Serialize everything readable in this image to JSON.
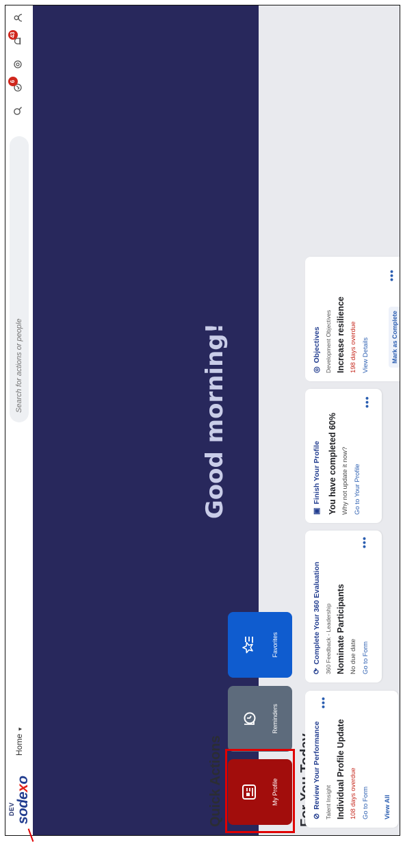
{
  "header": {
    "logo_dev": "DEV",
    "logo_word": "sodexo",
    "home_label": "Home",
    "search_placeholder": "Search for actions or people",
    "notifications_count": "6",
    "alerts_count": "43"
  },
  "banner": {
    "greeting": "Good morning!"
  },
  "quick_actions": {
    "title": "Quick Actions",
    "items": [
      {
        "label": "My Profile",
        "icon": "profile-card-icon",
        "color": "#a20d0c"
      },
      {
        "label": "Reminders",
        "icon": "reminder-icon",
        "color": "#5d6b7c"
      },
      {
        "label": "Favorites",
        "icon": "star-list-icon",
        "color": "#0f5ccf"
      }
    ]
  },
  "for_you": {
    "title": "For You Today",
    "cards": [
      {
        "title": "Review Your Performance",
        "subtitle": "Talent Insight",
        "main": "Individual Profile Update",
        "meta": "108 days overdue",
        "link": "Go to Form",
        "footer": "View All"
      },
      {
        "title": "Complete Your 360 Evaluation",
        "subtitle": "360 Feedback - Leadership",
        "main": "Nominate Participants",
        "meta": "No due date",
        "link": "Go to Form"
      },
      {
        "title": "Finish Your Profile",
        "main": "You have completed 60%",
        "meta": "Why not update it now?",
        "link": "Go to Your Profile"
      },
      {
        "title": "Objectives",
        "subtitle": "Development Objectives",
        "main": "Increase resilience",
        "meta": "198 days overdue",
        "link": "View Details",
        "button": "Mark as Complete"
      }
    ]
  }
}
